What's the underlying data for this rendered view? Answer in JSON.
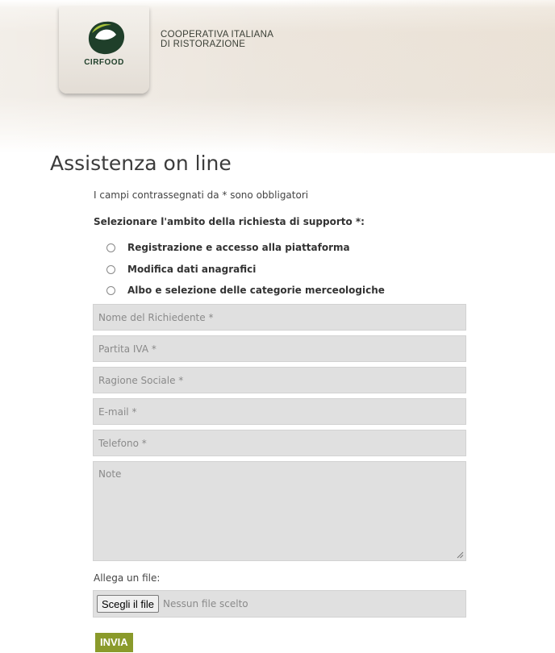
{
  "header": {
    "logo_text": "CIRFOOD",
    "tagline_line1": "COOPERATIVA ITALIANA",
    "tagline_line2": "DI RISTORAZIONE"
  },
  "page": {
    "title": "Assistenza on line"
  },
  "form": {
    "required_note": "I campi contrassegnati da * sono obbligatori",
    "scope_label": "Selezionare l'ambito della richiesta di supporto *:",
    "scope_options": [
      {
        "label": "Registrazione e accesso alla piattaforma"
      },
      {
        "label": "Modifica dati anagrafici"
      },
      {
        "label": "Albo e selezione delle categorie merceologiche"
      }
    ],
    "fields": {
      "nome": {
        "placeholder": "Nome del Richiedente *",
        "value": ""
      },
      "piva": {
        "placeholder": "Partita IVA *",
        "value": ""
      },
      "ragione": {
        "placeholder": "Ragione Sociale *",
        "value": ""
      },
      "email": {
        "placeholder": "E-mail *",
        "value": ""
      },
      "telefono": {
        "placeholder": "Telefono *",
        "value": ""
      },
      "note": {
        "placeholder": "Note",
        "value": ""
      }
    },
    "attach_label": "Allega un file:",
    "file_button": "Scegli il file",
    "file_status": "Nessun file scelto",
    "submit_label": "INVIA"
  },
  "colors": {
    "brand_green": "#8a9a2b",
    "logo_dark": "#1f3f2a",
    "logo_light": "#a9c43a"
  }
}
